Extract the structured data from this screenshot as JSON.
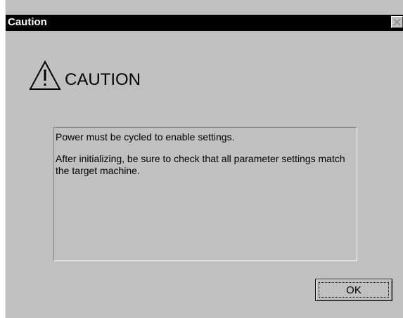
{
  "window": {
    "title": "Caution",
    "close_icon": "close-icon"
  },
  "heading": {
    "icon": "warning-triangle-icon",
    "text": "CAUTION"
  },
  "message": {
    "line1": "Power must be cycled to enable settings.",
    "line2": "After initializing, be sure to check that all parameter settings match the target machine."
  },
  "buttons": {
    "ok_label": "OK"
  },
  "colors": {
    "dialog_background": "#c0c0c0",
    "titlebar_background": "#000000",
    "title_text": "#ffffff"
  }
}
